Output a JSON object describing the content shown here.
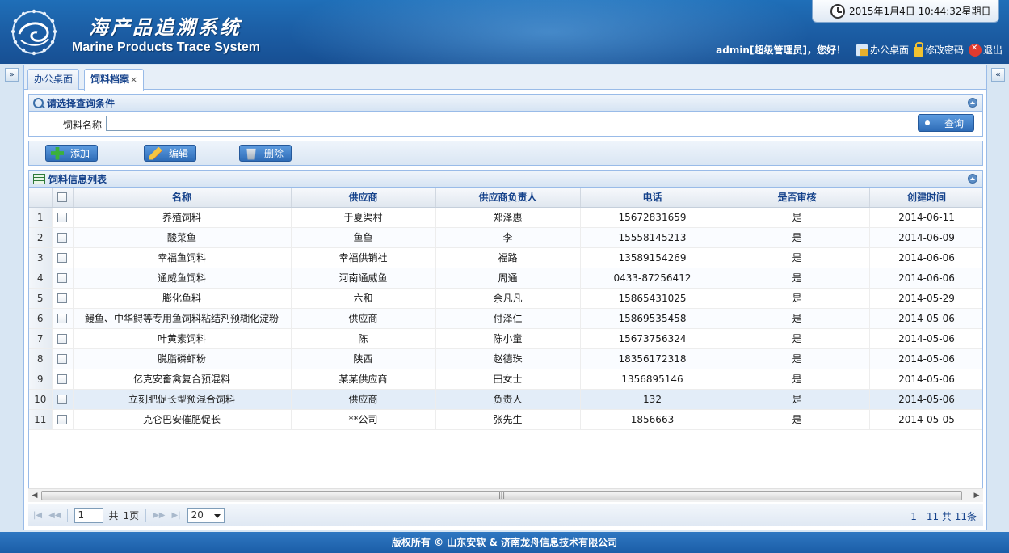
{
  "header": {
    "title_cn": "海产品追溯系统",
    "title_en": "Marine Products Trace System",
    "clock": "2015年1月4日 10:44:32星期日",
    "user": "admin[超级管理员]，您好！",
    "links": {
      "desktop": "办公桌面",
      "password": "修改密码",
      "logout": "退出"
    }
  },
  "side": {
    "left_toggle": "»",
    "right_toggle": "«"
  },
  "tabs": [
    {
      "label": "办公桌面"
    },
    {
      "label": "饲料档案",
      "close": "×"
    }
  ],
  "query": {
    "title": "请选择查询条件",
    "field_label": "饲料名称",
    "field_value": "",
    "button": "查询"
  },
  "toolbar": {
    "add": "添加",
    "edit": "编辑",
    "delete": "删除"
  },
  "grid": {
    "title": "饲料信息列表",
    "columns": [
      "名称",
      "供应商",
      "供应商负责人",
      "电话",
      "是否审核",
      "创建时间"
    ],
    "rows": [
      {
        "n": "1",
        "name": "养殖饲料",
        "supplier": "于夏渠村",
        "owner": "郑泽惠",
        "phone": "15672831659",
        "audited": "是",
        "created": "2014-06-11"
      },
      {
        "n": "2",
        "name": "酸菜鱼",
        "supplier": "鱼鱼",
        "owner": "李",
        "phone": "15558145213",
        "audited": "是",
        "created": "2014-06-09"
      },
      {
        "n": "3",
        "name": "幸福鱼饲料",
        "supplier": "幸福供销社",
        "owner": "福路",
        "phone": "13589154269",
        "audited": "是",
        "created": "2014-06-06"
      },
      {
        "n": "4",
        "name": "通威鱼饲料",
        "supplier": "河南通威鱼",
        "owner": "周通",
        "phone": "0433-87256412",
        "audited": "是",
        "created": "2014-06-06"
      },
      {
        "n": "5",
        "name": "膨化鱼料",
        "supplier": "六和",
        "owner": "余凡凡",
        "phone": "15865431025",
        "audited": "是",
        "created": "2014-05-29"
      },
      {
        "n": "6",
        "name": "鳗鱼、中华鲟等专用鱼饲料粘结剂预糊化淀粉",
        "supplier": "供应商",
        "owner": "付泽仁",
        "phone": "15869535458",
        "audited": "是",
        "created": "2014-05-06"
      },
      {
        "n": "7",
        "name": "叶黄素饲料",
        "supplier": "陈",
        "owner": "陈小童",
        "phone": "15673756324",
        "audited": "是",
        "created": "2014-05-06"
      },
      {
        "n": "8",
        "name": "脱脂磷虾粉",
        "supplier": "陕西",
        "owner": "赵德珠",
        "phone": "18356172318",
        "audited": "是",
        "created": "2014-05-06"
      },
      {
        "n": "9",
        "name": "亿克安畜禽复合预混料",
        "supplier": "某某供应商",
        "owner": "田女士",
        "phone": "1356895146",
        "audited": "是",
        "created": "2014-05-06"
      },
      {
        "n": "10",
        "name": "立刻肥促长型预混合饲料",
        "supplier": "供应商",
        "owner": "负责人",
        "phone": "132",
        "audited": "是",
        "created": "2014-05-06"
      },
      {
        "n": "11",
        "name": "克仑巴安催肥促长",
        "supplier": "**公司",
        "owner": "张先生",
        "phone": "1856663",
        "audited": "是",
        "created": "2014-05-05"
      }
    ]
  },
  "pager": {
    "page": "1",
    "total_pages_prefix": "共",
    "total_pages": "1页",
    "page_size": "20",
    "summary": "1 - 11   共 11条"
  },
  "footer": "版权所有 © 山东安软 & 济南龙舟信息技术有限公司"
}
